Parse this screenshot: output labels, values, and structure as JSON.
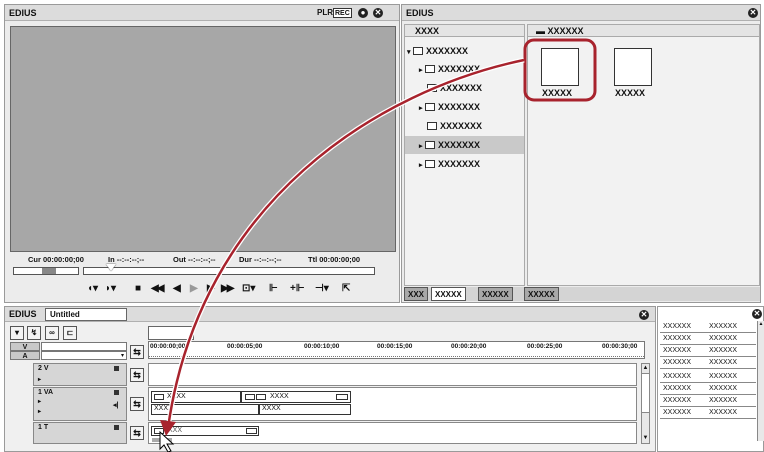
{
  "player": {
    "title": "EDIUS",
    "plr": "PLR",
    "rec": "REC",
    "minimize": "●",
    "close": "✕",
    "timecodes": {
      "cur": "Cur 00:00:00;00",
      "in": "In --:--:--;--",
      "out": "Out --:--:--;--",
      "dur": "Dur --:--:--;--",
      "ttl": "Ttl 00:00:00;00"
    },
    "controls": [
      "◖▾",
      "◗▾",
      "■",
      "◀◀",
      "◀",
      "▶",
      "▶",
      "▶▶",
      "⊡▾",
      "⊩",
      "+⊩",
      "⊣▾",
      "⇱"
    ]
  },
  "bin": {
    "title": "EDIUS",
    "close": "✕",
    "tree_header": "XXXX",
    "content_header": "XXXXXX",
    "tree": [
      {
        "label": "XXXXXXX",
        "prefix": "▾",
        "open": true
      },
      {
        "label": "XXXXXXX",
        "prefix": "▸"
      },
      {
        "label": "XXXXXXX",
        "prefix": ""
      },
      {
        "label": "XXXXXXX",
        "prefix": "▸"
      },
      {
        "label": "XXXXXXX",
        "prefix": ""
      },
      {
        "label": "XXXXXXX",
        "prefix": "▸",
        "selected": true
      },
      {
        "label": "XXXXXXX",
        "prefix": "▸"
      }
    ],
    "clips": [
      "XXXXX",
      "XXXXX"
    ],
    "tabs": [
      "XXX",
      "XXXXX",
      "XXXXX",
      "XXXXX"
    ]
  },
  "timeline": {
    "title": "EDIUS",
    "sequence": "Untitled",
    "close": "✕",
    "ruler": [
      "00:00:00;00",
      "00:00:05;00",
      "00:00:10;00",
      "00:00:15;00",
      "00:00:20;00",
      "00:00:25;00",
      "00:00:30;00"
    ],
    "tracks": {
      "v": "V",
      "a": "A",
      "v2": "2 V",
      "va1": "1 VA",
      "t1": "1 T"
    },
    "clips": {
      "va_a": "XXXX",
      "va_b": "XXXX",
      "va_a2": "XXXX",
      "va_b2": "XXXX",
      "t_a": "XXX"
    }
  },
  "side_table": {
    "rows": [
      [
        "XXXXXX",
        "XXXXXX"
      ],
      [
        "XXXXXX",
        "XXXXXX"
      ],
      [
        "XXXXXX",
        "XXXXXX"
      ],
      [
        "XXXXXX",
        "XXXXXX"
      ],
      [
        "XXXXXX",
        "XXXXXX"
      ],
      [
        "XXXXXX",
        "XXXXXX"
      ],
      [
        "XXXXXX",
        "XXXXXX"
      ],
      [
        "XXXXXX",
        "XXXXXX"
      ]
    ],
    "close": "✕"
  },
  "colors": {
    "highlight": "#a8232d",
    "monitor": "#a7a7a7",
    "selected": "#c9c9c9"
  }
}
